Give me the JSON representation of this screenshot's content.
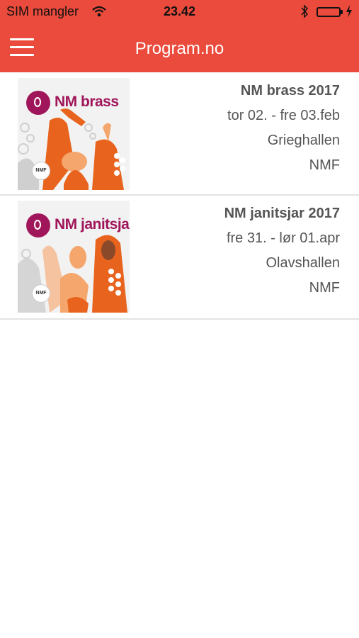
{
  "status": {
    "carrier": "SIM mangler",
    "time": "23.42"
  },
  "nav": {
    "title": "Program.no",
    "menu_icon": "hamburger-icon"
  },
  "events": [
    {
      "logo_text": "NM brass",
      "title": "NM brass 2017",
      "dates": "tor 02. - fre 03.feb",
      "venue": "Grieghallen",
      "organizer": "NMF",
      "badge": "NMF"
    },
    {
      "logo_text": "NM janitsjar",
      "title": "NM janitsjar 2017",
      "dates": "fre 31. - lør 01.apr",
      "venue": "Olavshallen",
      "organizer": "NMF",
      "badge": "NMF"
    }
  ],
  "colors": {
    "brand": "#ea4b3c",
    "logo": "#a0165a",
    "art": "#e8641e"
  }
}
